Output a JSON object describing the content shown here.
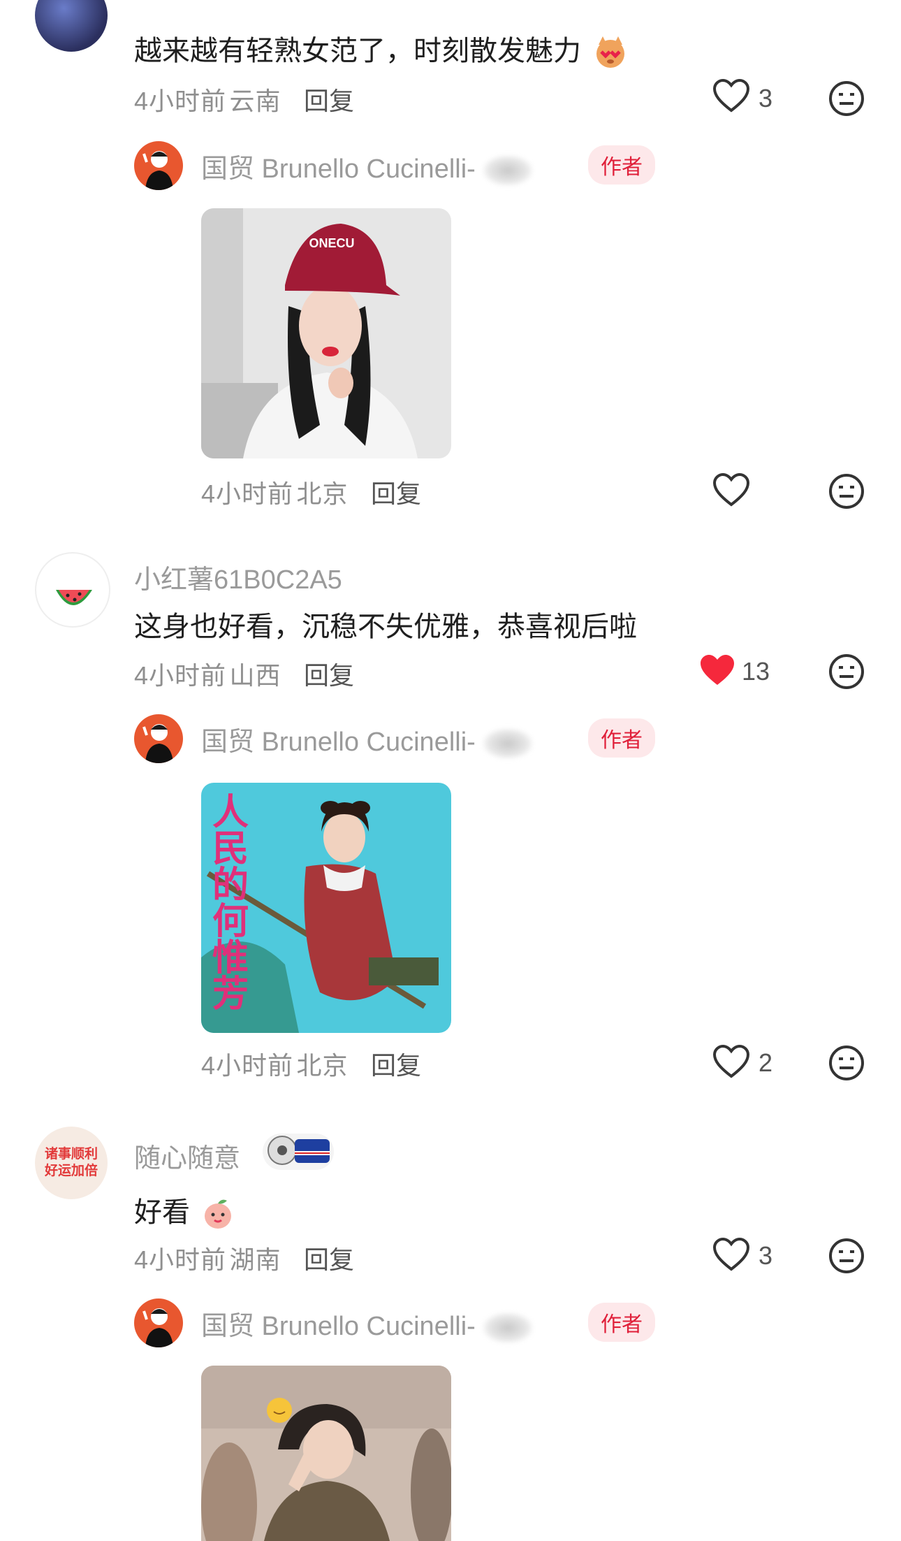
{
  "comments": [
    {
      "text": "越来越有轻熟女范了，时刻散发魅力",
      "time": "4小时前",
      "location": "云南",
      "reply": "回复",
      "likes": "3",
      "liked": false,
      "author_reply": {
        "username": "国贸 Brunello Cucinelli-",
        "badge": "作者",
        "time": "4小时前",
        "location": "北京",
        "reply": "回复",
        "likes": "",
        "image_caption": "ONECU"
      }
    },
    {
      "username": "小红薯61B0C2A5",
      "text": "这身也好看，沉稳不失优雅，恭喜视后啦",
      "time": "4小时前",
      "location": "山西",
      "reply": "回复",
      "likes": "13",
      "liked": true,
      "author_reply": {
        "username": "国贸 Brunello Cucinelli-",
        "badge": "作者",
        "time": "4小时前",
        "location": "北京",
        "reply": "回复",
        "likes": "2",
        "image_caption": "人民的何惟芳"
      }
    },
    {
      "username": "随心随意",
      "avatar_text": "诸事顺利好运加倍",
      "text": "好看",
      "time": "4小时前",
      "location": "湖南",
      "reply": "回复",
      "likes": "3",
      "liked": false,
      "author_reply": {
        "username": "国贸 Brunello Cucinelli-",
        "badge": "作者"
      }
    }
  ],
  "colors": {
    "like_active": "#f5283c",
    "badge_bg": "#fde8ea",
    "badge_text": "#e0203a"
  }
}
